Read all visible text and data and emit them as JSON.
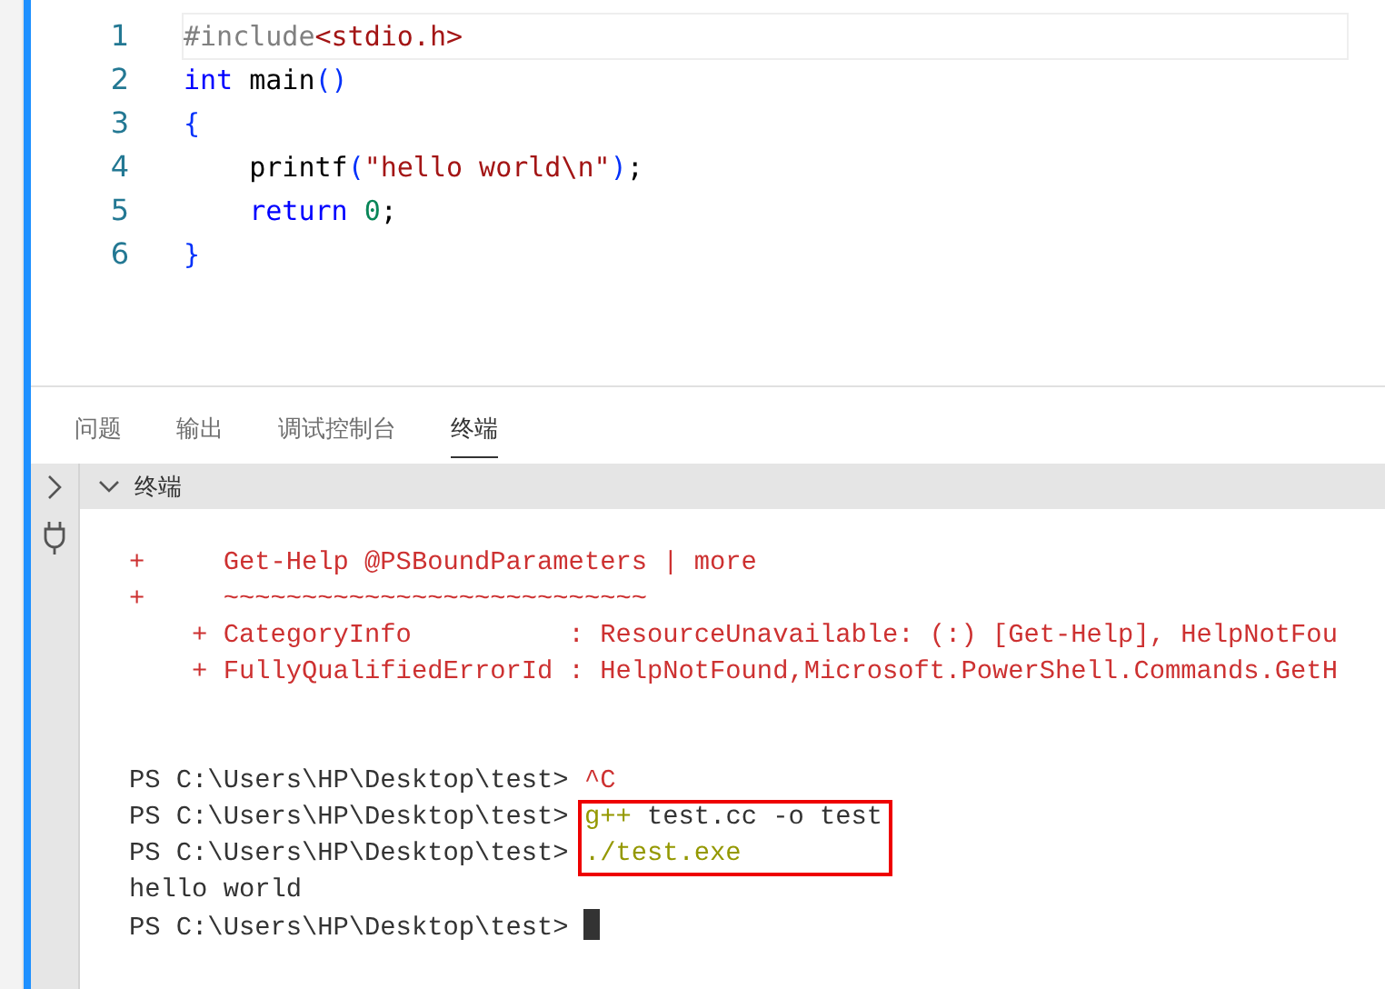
{
  "editor": {
    "lines": [
      {
        "number": "1",
        "tokens": [
          {
            "text": "#include",
            "kind": "directive"
          },
          {
            "text": "<stdio.h>",
            "kind": "string"
          }
        ]
      },
      {
        "number": "2",
        "tokens": [
          {
            "text": "int",
            "kind": "keyword"
          },
          {
            "text": " main",
            "kind": "plain"
          },
          {
            "text": "()",
            "kind": "paren"
          }
        ]
      },
      {
        "number": "3",
        "tokens": [
          {
            "text": "{",
            "kind": "brace"
          }
        ]
      },
      {
        "number": "4",
        "tokens": [
          {
            "text": "    printf",
            "kind": "plain"
          },
          {
            "text": "(",
            "kind": "paren"
          },
          {
            "text": "\"hello world\\n\"",
            "kind": "string"
          },
          {
            "text": ")",
            "kind": "paren"
          },
          {
            "text": ";",
            "kind": "plain"
          }
        ]
      },
      {
        "number": "5",
        "tokens": [
          {
            "text": "    return",
            "kind": "keyword"
          },
          {
            "text": " 0",
            "kind": "number"
          },
          {
            "text": ";",
            "kind": "plain"
          }
        ]
      },
      {
        "number": "6",
        "tokens": [
          {
            "text": "}",
            "kind": "brace"
          }
        ]
      }
    ]
  },
  "panel": {
    "tabs": [
      {
        "label": "问题",
        "selected": false
      },
      {
        "label": "输出",
        "selected": false
      },
      {
        "label": "调试控制台",
        "selected": false
      },
      {
        "label": "终端",
        "selected": true
      }
    ],
    "terminal": {
      "title": "终端",
      "lines": [
        {
          "kind": "error",
          "text": "+     Get-Help @PSBoundParameters | more"
        },
        {
          "kind": "error",
          "text": "+     ~~~~~~~~~~~~~~~~~~~~~~~~~~~"
        },
        {
          "kind": "error",
          "text": "    + CategoryInfo          : ResourceUnavailable: (:) [Get-Help], HelpNotFou"
        },
        {
          "kind": "error",
          "text": "    + FullyQualifiedErrorId : HelpNotFound,Microsoft.PowerShell.Commands.GetH"
        },
        {
          "kind": "blank"
        },
        {
          "kind": "blank"
        },
        {
          "kind": "prompt",
          "prompt": "PS C:\\Users\\HP\\Desktop\\test> ",
          "command": [
            {
              "text": "^C",
              "kind": "interrupt"
            }
          ]
        },
        {
          "kind": "prompt",
          "prompt": "PS C:\\Users\\HP\\Desktop\\test> ",
          "command": [
            {
              "text": "g++",
              "kind": "exe"
            },
            {
              "text": " test.cc -o test",
              "kind": "arg"
            }
          ],
          "boxed": true
        },
        {
          "kind": "prompt",
          "prompt": "PS C:\\Users\\HP\\Desktop\\test> ",
          "command": [
            {
              "text": "./test.exe",
              "kind": "exe"
            }
          ],
          "boxed": true
        },
        {
          "kind": "output",
          "text": "hello world"
        },
        {
          "kind": "prompt",
          "prompt": "PS C:\\Users\\HP\\Desktop\\test> ",
          "cursor": true
        }
      ]
    }
  }
}
